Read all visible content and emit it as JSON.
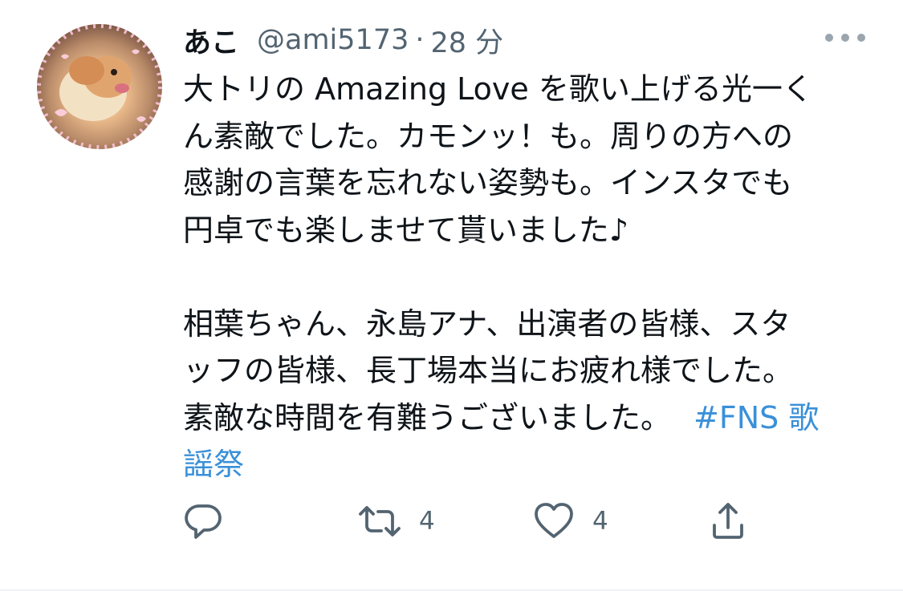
{
  "user": {
    "display_name": "あこ",
    "handle": "@ami5173",
    "separator": "·",
    "time": "28 分"
  },
  "tweet": {
    "para1_line1": "大トリの Amazing Love を歌い上げる光一く",
    "para1_line2": "ん素敵でした。カモンッ！も。周りの方への",
    "para1_line3": "感謝の言葉を忘れない姿勢も。インスタでも",
    "para1_line4": "円卓でも楽しませて貰いました♪",
    "para2_line1": "相葉ちゃん、永島アナ、出演者の皆様、スタ",
    "para2_line2": "ッフの皆様、長丁場本当にお疲れ様でした。",
    "para2_line3_text": "素敵な時間を有難うございました。",
    "hashtag_part1": "#FNS 歌",
    "hashtag_part2": "謡祭"
  },
  "actions": {
    "reply_icon": "reply-icon",
    "retweet_icon": "retweet-icon",
    "retweet_count": "4",
    "like_icon": "heart-icon",
    "like_count": "4",
    "share_icon": "share-icon"
  },
  "colors": {
    "text": "#0f1419",
    "secondary": "#536471",
    "hashtag": "#3a90d8"
  }
}
